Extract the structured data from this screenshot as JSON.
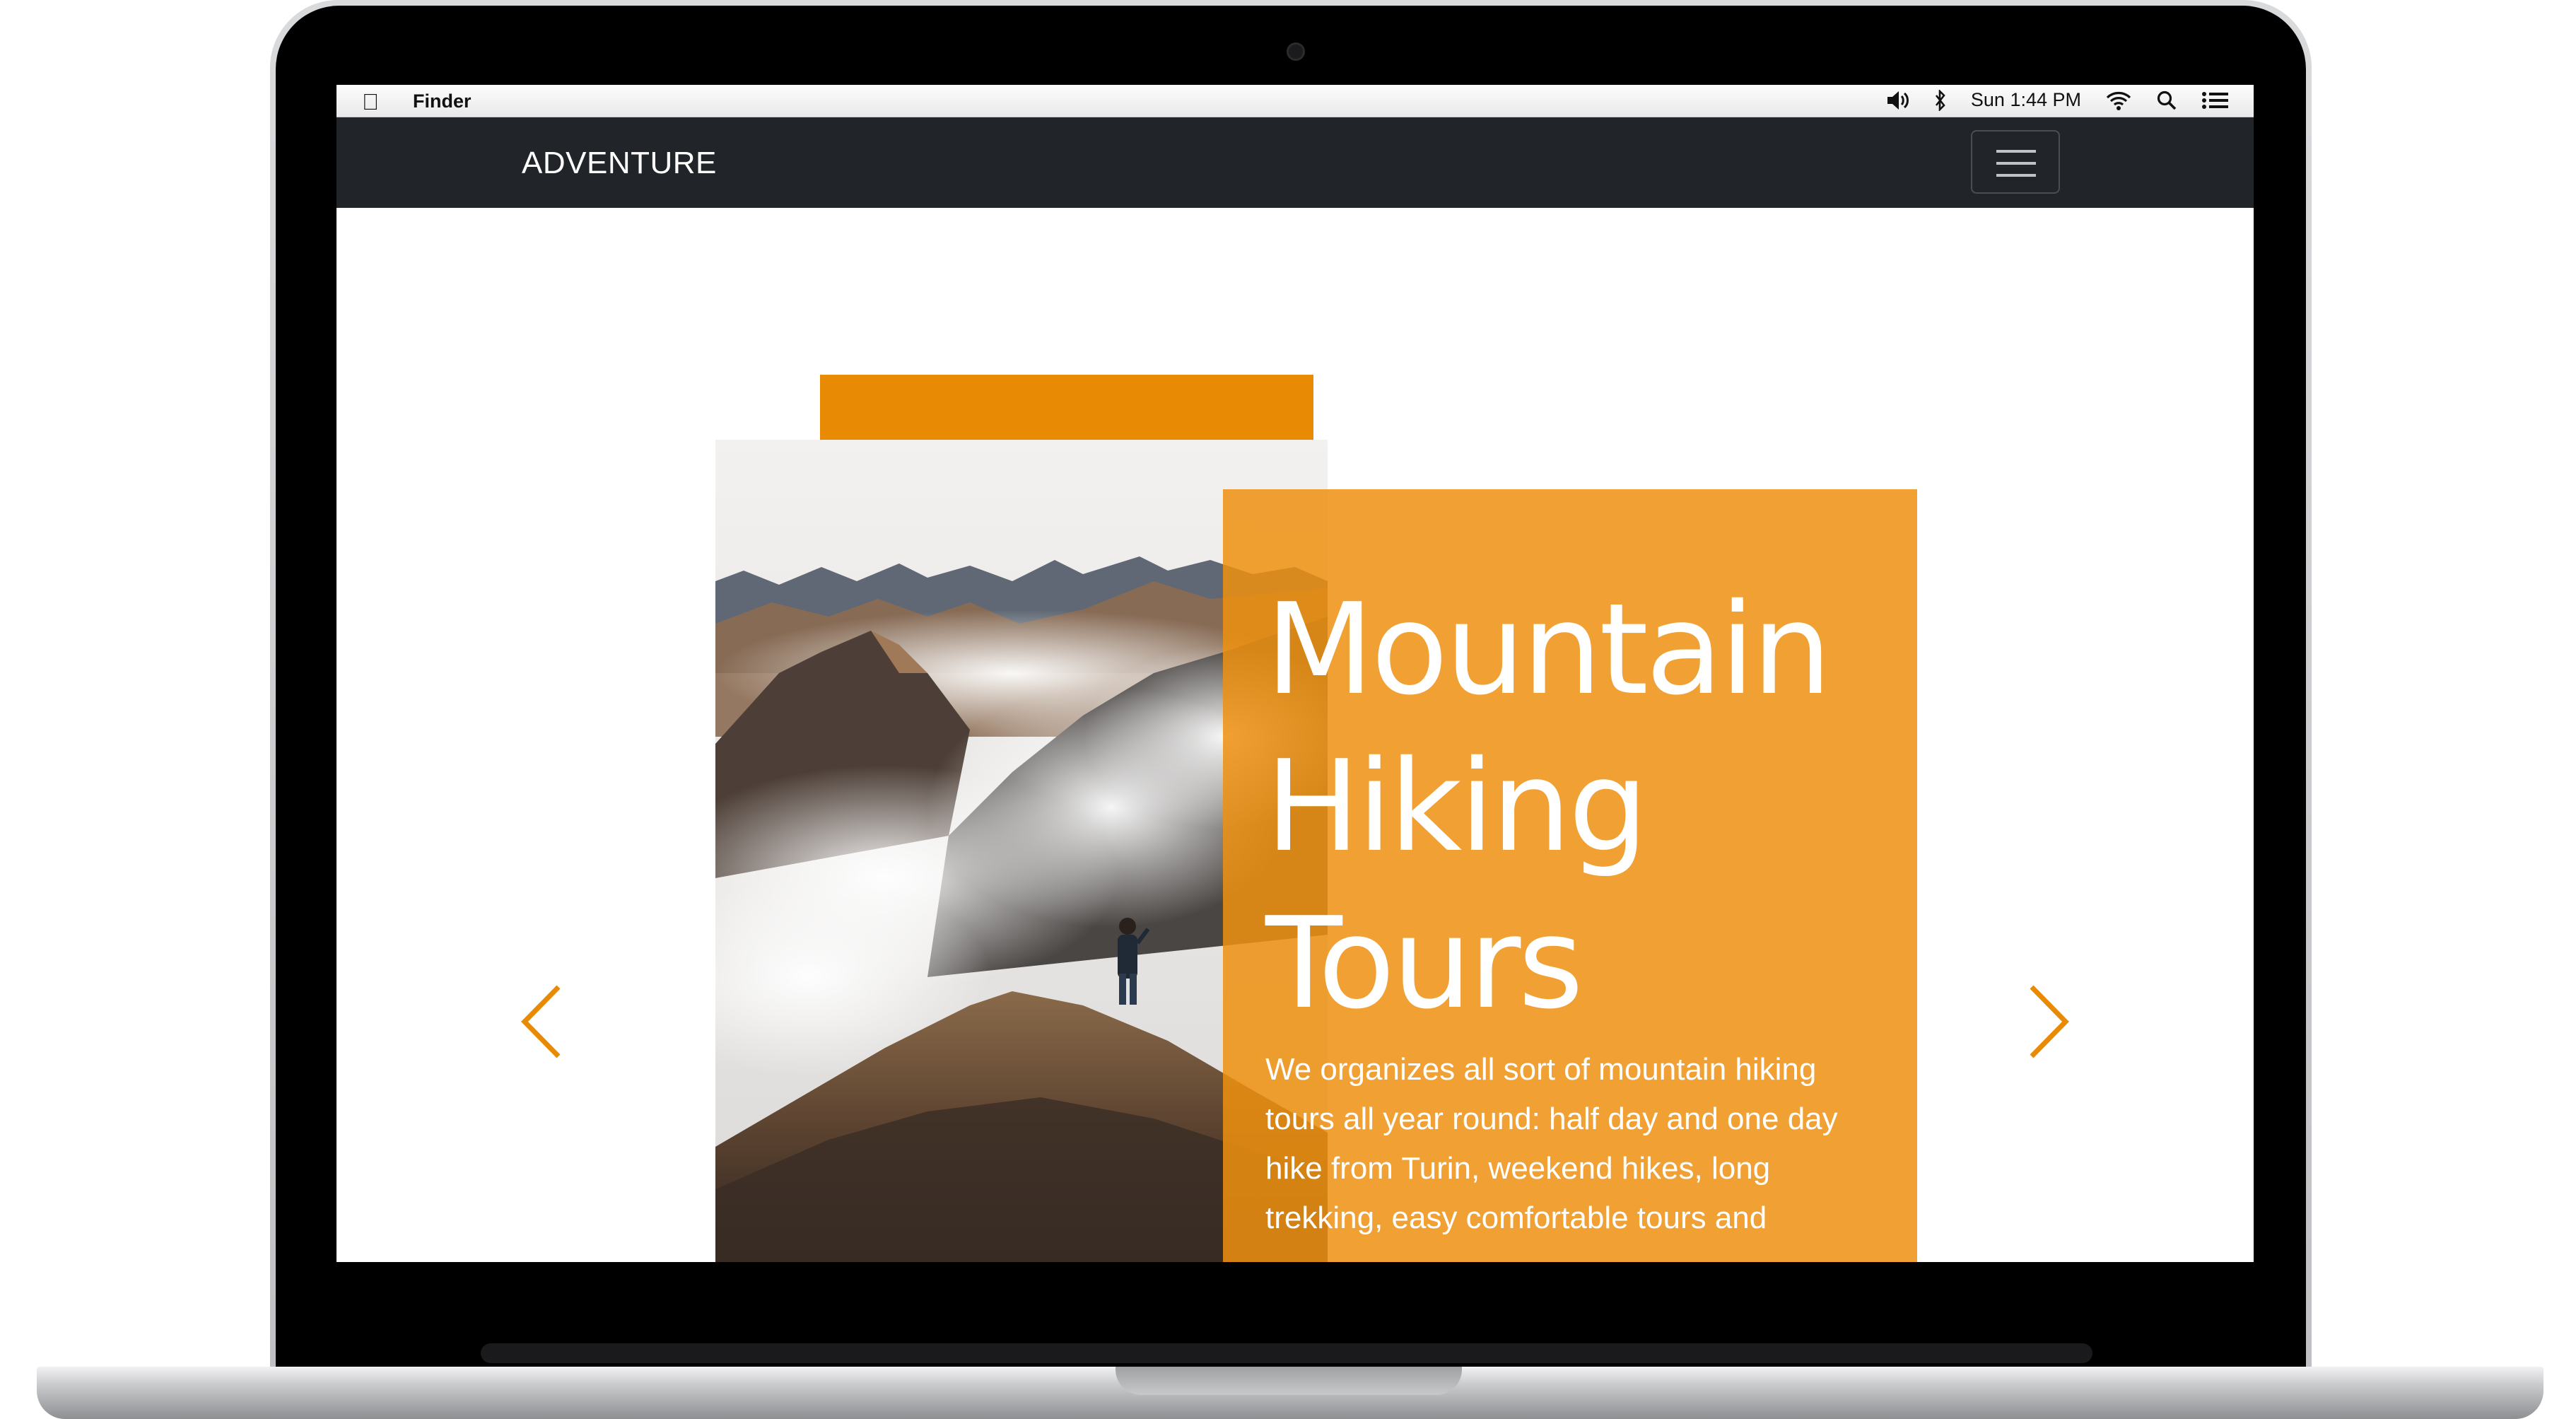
{
  "menubar": {
    "app_name": "Finder",
    "clock": "Sun 1:44 PM",
    "icons": [
      "apple-icon",
      "volume-icon",
      "bluetooth-icon",
      "wifi-icon",
      "spotlight-search-icon",
      "notification-list-icon"
    ]
  },
  "navbar": {
    "brand": "ADVENTURE",
    "toggler_icon": "hamburger-menu-icon"
  },
  "hero": {
    "title_lines": [
      "Mountain",
      "Hiking",
      "Tours"
    ],
    "description": "We organizes all sort of mountain hiking tours all year round: half day and one day hike from Turin, weekend hikes, long trekking, easy comfortable tours and",
    "image": "hiker-on-mountain-ridge-above-clouds",
    "prev_icon": "chevron-left-icon",
    "next_icon": "chevron-right-icon"
  },
  "colors": {
    "accent": "#e98a05",
    "overlay": "#ee910f",
    "navbar": "#212529"
  }
}
